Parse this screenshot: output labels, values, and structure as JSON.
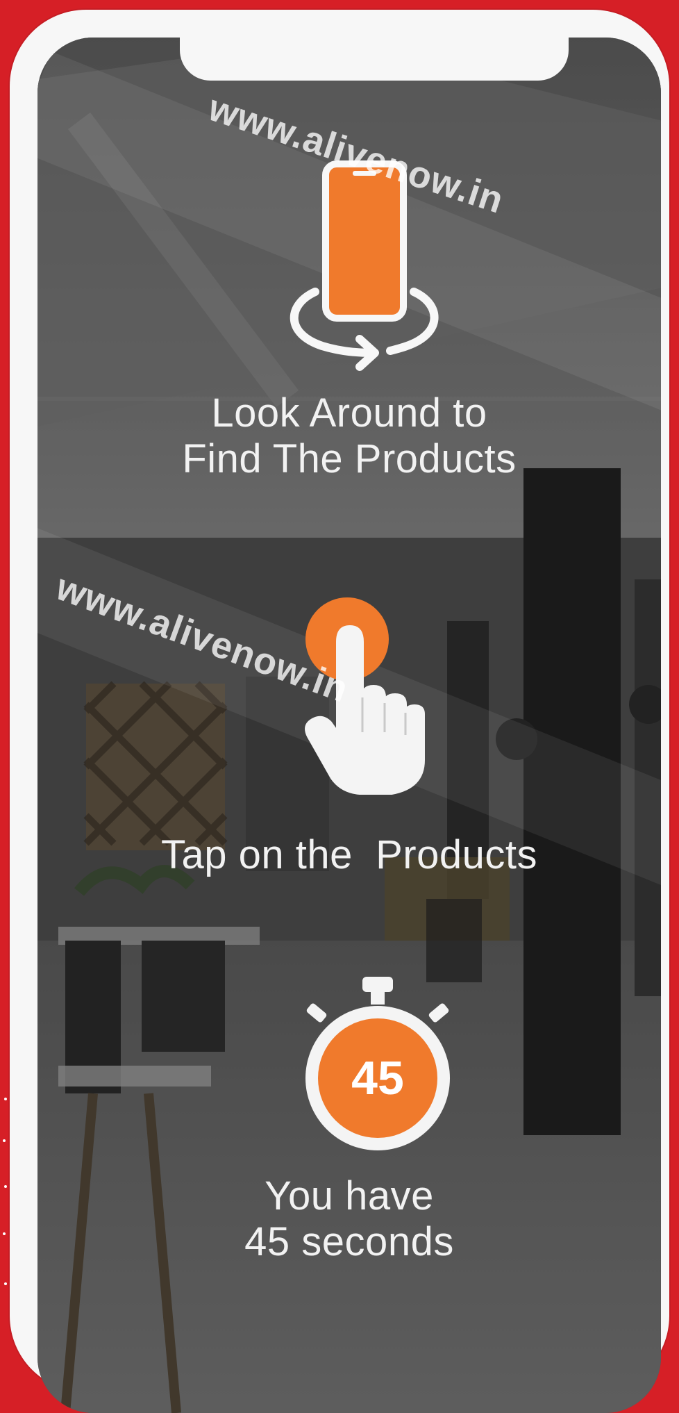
{
  "colors": {
    "background": "#d61f26",
    "accent": "#f07a2c",
    "frame": "#f7f7f7",
    "text": "#f2f2f2"
  },
  "watermarks": [
    "www.alivenow.in",
    "www.alivenow.in"
  ],
  "steps": [
    {
      "icon": "phone-rotate-icon",
      "label_lines": [
        "Look Around to",
        "Find The Products"
      ]
    },
    {
      "icon": "tap-hand-icon",
      "label_lines": [
        "Tap on the  Products"
      ]
    },
    {
      "icon": "stopwatch-icon",
      "timer_value": "45",
      "label_lines": [
        "You have",
        "45 seconds"
      ]
    }
  ]
}
